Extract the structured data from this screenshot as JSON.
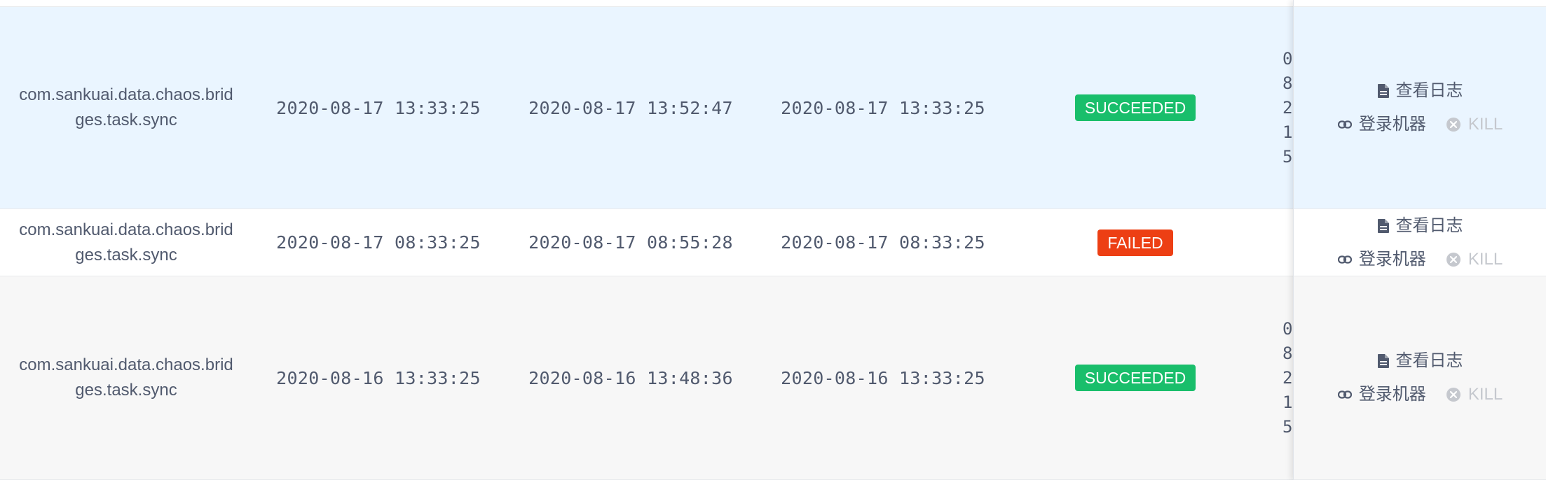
{
  "rows": [
    {
      "task": "com.sankuai.data.chaos.bridges.task.sync",
      "time1": "2020-08-17 13:33:25",
      "time2": "2020-08-17 13:52:47",
      "time3": "2020-08-17 13:33:25",
      "status": "SUCCEEDED",
      "status_color": "#19be6b",
      "clipped": "0\n8\n2\n1\n5",
      "view_log": "查看日志",
      "login": "登录机器",
      "kill": "KILL"
    },
    {
      "task": "com.sankuai.data.chaos.bridges.task.sync",
      "time1": "2020-08-17 08:33:25",
      "time2": "2020-08-17 08:55:28",
      "time3": "2020-08-17 08:33:25",
      "status": "FAILED",
      "status_color": "#ed3f14",
      "clipped": "",
      "view_log": "查看日志",
      "login": "登录机器",
      "kill": "KILL"
    },
    {
      "task": "com.sankuai.data.chaos.bridges.task.sync",
      "time1": "2020-08-16 13:33:25",
      "time2": "2020-08-16 13:48:36",
      "time3": "2020-08-16 13:33:25",
      "status": "SUCCEEDED",
      "status_color": "#19be6b",
      "clipped": "0\n8\n2\n1\n5",
      "view_log": "查看日志",
      "login": "登录机器",
      "kill": "KILL"
    }
  ],
  "icons": {
    "view_log": "file-text-icon",
    "login": "link-icon",
    "kill": "close-circle-icon"
  },
  "colors": {
    "row_highlight": "#eaf5ff",
    "row_striped": "#f7f7f7",
    "success": "#19be6b",
    "failed": "#ed3f14",
    "disabled": "#c5c8ce"
  }
}
